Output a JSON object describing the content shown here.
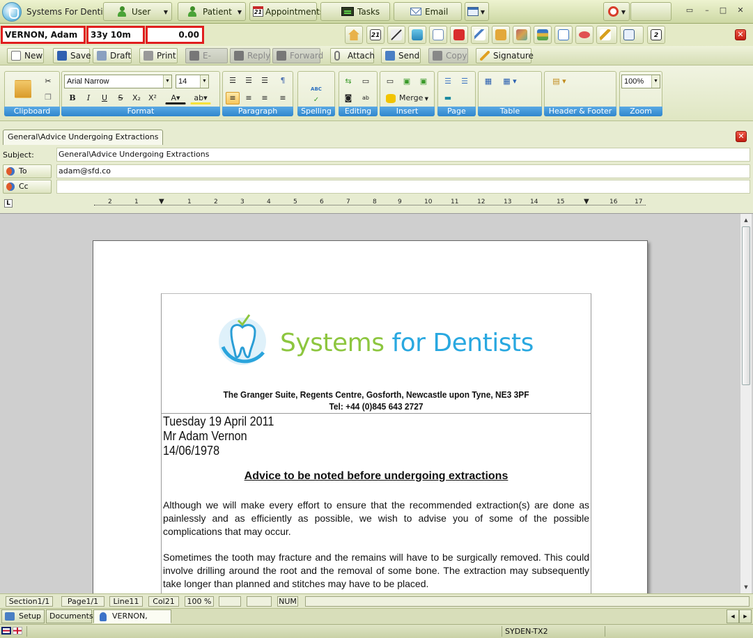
{
  "app": {
    "title": "Systems For Dentists"
  },
  "nav": {
    "user": "User",
    "patient": "Patient",
    "appointments": "Appointments",
    "appointments_day": "21",
    "tasks": "Tasks",
    "email": "Email"
  },
  "patient": {
    "name": "VERNON, Adam",
    "age": "33y 10m",
    "balance": "0.00",
    "toolbar_day": "21",
    "toolbar_day2": "2"
  },
  "toolbar": {
    "new": "New",
    "save": "Save",
    "draft": "Draft",
    "print": "Print",
    "email": "E-mail",
    "reply": "Reply",
    "forward": "Forward",
    "attach": "Attach",
    "send": "Send",
    "copy": "Copy",
    "signature": "Signature"
  },
  "ribbon": {
    "font_name": "Arial Narrow",
    "font_size": "14",
    "merge": "Merge",
    "zoom": "100%",
    "groups": {
      "clipboard": "Clipboard",
      "format": "Format",
      "paragraph": "Paragraph",
      "spelling": "Spelling",
      "editing": "Editing",
      "insert": "Insert",
      "page": "Page",
      "table": "Table",
      "header_footer": "Header & Footer",
      "zoom": "Zoom"
    },
    "spelling_glyph": "ABC"
  },
  "doc_tab": "General\\Advice Undergoing Extractions",
  "fields": {
    "subject_label": "Subject:",
    "subject": "General\\Advice Undergoing Extractions",
    "to_label": "To",
    "to": "adam@sfd.co",
    "cc_label": "Cc",
    "cc": ""
  },
  "ruler": {
    "tab_selector": "L",
    "marks": [
      "2",
      "1",
      "1",
      "2",
      "3",
      "4",
      "5",
      "6",
      "7",
      "8",
      "9",
      "10",
      "11",
      "12",
      "13",
      "14",
      "15",
      "16",
      "17",
      "18"
    ]
  },
  "letter": {
    "logo_word1": "Systems",
    "logo_word2": "for Dentists",
    "address": "The Granger Suite, Regents Centre, Gosforth, Newcastle upon Tyne, NE3 3PF",
    "tel": "Tel: +44 (0)845 643 2727",
    "date": "Tuesday 19 April 2011",
    "recipient": "Mr Adam Vernon",
    "dob": "14/06/1978",
    "heading": "Advice to be noted before undergoing extractions",
    "para1": "Although we will make every effort to ensure that the recommended extraction(s) are done as painlessly and as efficiently as possible, we wish to advise you of some of the possible complications that may occur.",
    "para2": "Sometimes the tooth may fracture and the remains will have to be surgically removed. This could involve drilling around the root and the removal of some bone. The extraction may subsequently take longer than planned and stitches may have to be placed."
  },
  "status": {
    "section": "Section1/1",
    "page": "Page1/1",
    "line": "Line11",
    "col": "Col21",
    "zoom": "100 %",
    "num": "NUM"
  },
  "bottom_tabs": {
    "setup": "Setup",
    "documents": "Documents",
    "patient": "VERNON, Adam"
  },
  "footer": {
    "machine": "SYDEN-TX2"
  },
  "colors": {
    "accent_green": "#8dc63f",
    "accent_blue": "#29a8e0",
    "alert_red": "#e01e1e",
    "ribbon_label": "#2f86cd"
  }
}
